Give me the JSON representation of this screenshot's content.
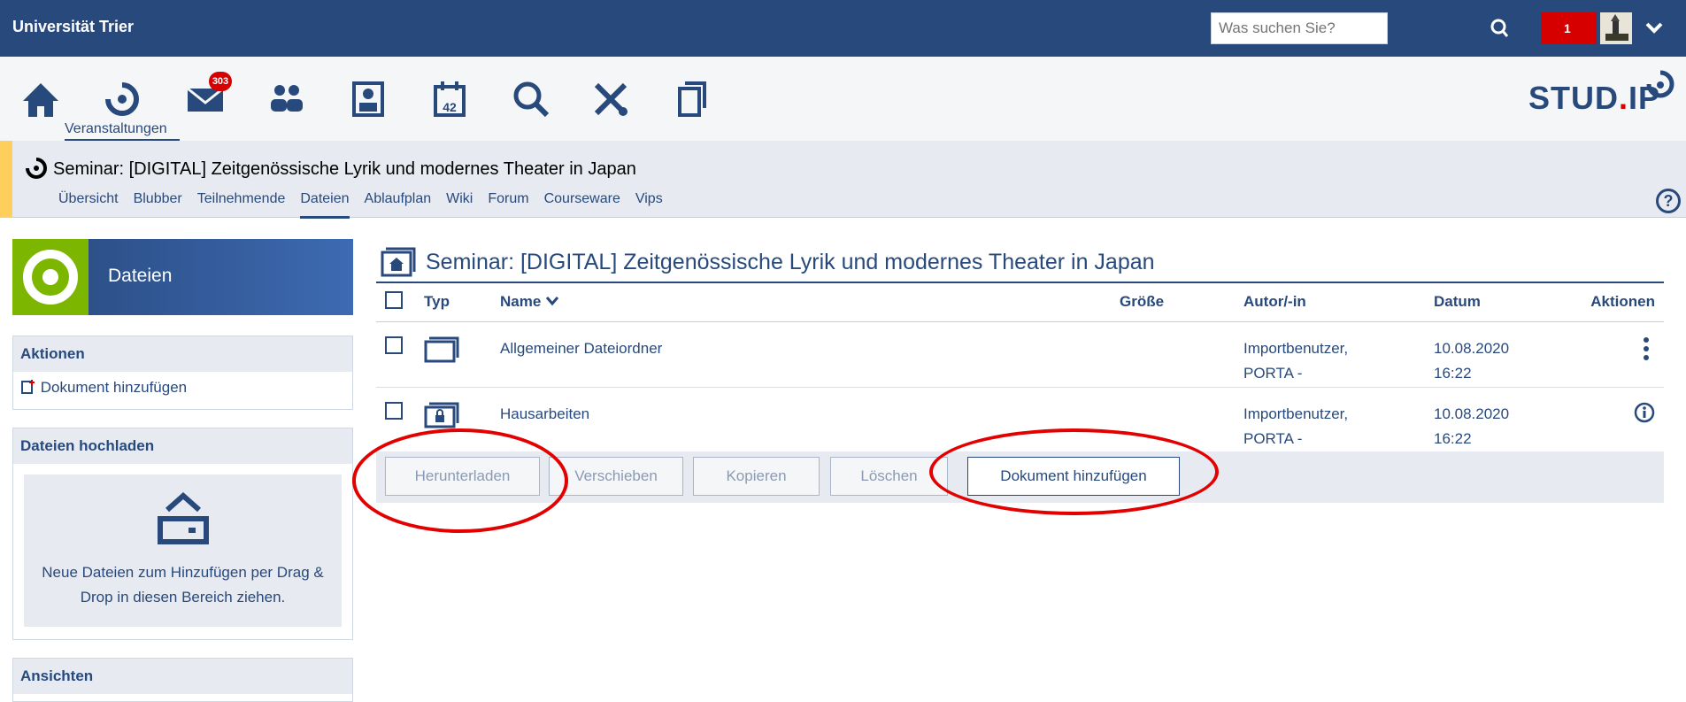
{
  "topbar": {
    "university": "Universität Trier",
    "search_placeholder": "Was suchen Sie?",
    "notifications": "1"
  },
  "iconnav": {
    "label": "Veranstaltungen",
    "mail_badge": "303",
    "logo_prefix": "STUD",
    "logo_dot": ".",
    "logo_suffix": "IP"
  },
  "context": {
    "title": "Seminar: [DIGITAL] Zeitgenössische Lyrik und modernes Theater in Japan",
    "tabs": [
      "Übersicht",
      "Blubber",
      "Teilnehmende",
      "Dateien",
      "Ablaufplan",
      "Wiki",
      "Forum",
      "Courseware",
      "Vips"
    ],
    "help": "?"
  },
  "sidebar": {
    "title": "Dateien",
    "actions_header": "Aktionen",
    "add_document": "Dokument hinzufügen",
    "upload_header": "Dateien hochladen",
    "drop_text": "Neue Dateien zum Hinzufügen per Drag & Drop in diesen Bereich ziehen.",
    "views_header": "Ansichten"
  },
  "main": {
    "title": "Seminar: [DIGITAL] Zeitgenössische Lyrik und modernes Theater in Japan",
    "columns": {
      "typ": "Typ",
      "name": "Name",
      "size": "Größe",
      "author": "Autor/-in",
      "date": "Datum",
      "actions": "Aktionen"
    },
    "rows": [
      {
        "name": "Allgemeiner Dateiordner",
        "author1": "Importbenutzer,",
        "author2": "PORTA -",
        "date1": "10.08.2020",
        "date2": "16:22"
      },
      {
        "name": "Hausarbeiten",
        "author1": "Importbenutzer,",
        "author2": "PORTA -",
        "date1": "10.08.2020",
        "date2": "16:22"
      }
    ],
    "buttons": {
      "download": "Herunterladen",
      "move": "Verschieben",
      "copy": "Kopieren",
      "delete": "Löschen",
      "add": "Dokument hinzufügen"
    }
  },
  "colors": {
    "primary": "#28497c",
    "accent": "#d60000",
    "annotation": "#e30000"
  }
}
